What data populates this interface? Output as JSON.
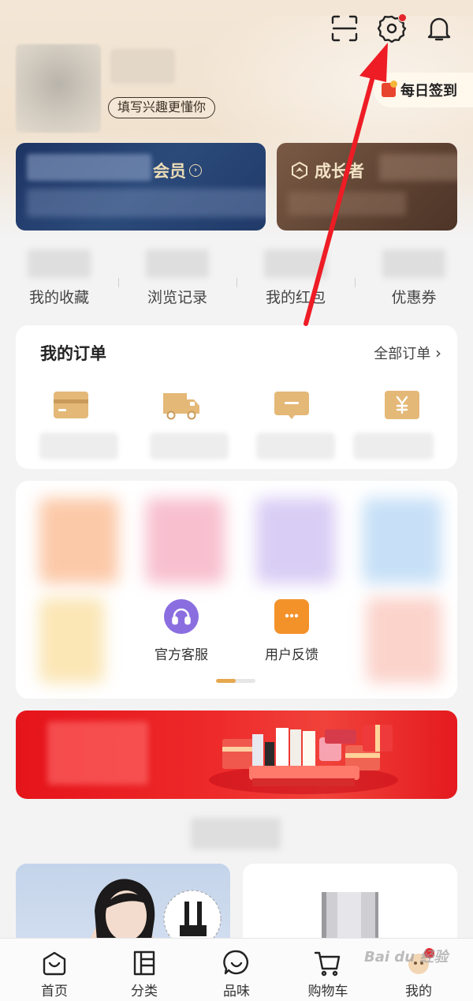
{
  "profile": {
    "interest_pill": "填写兴趣更懂你",
    "checkin_label": "每日签到"
  },
  "cards": {
    "member_title": "会员",
    "growth_title": "成长者"
  },
  "quick_stats": [
    {
      "label": "我的收藏"
    },
    {
      "label": "浏览记录"
    },
    {
      "label": "我的红包"
    },
    {
      "label": "优惠券"
    }
  ],
  "orders": {
    "title": "我的订单",
    "all_label": "全部订单",
    "icons": [
      "wallet-icon",
      "truck-icon",
      "comment-icon",
      "refund-icon"
    ]
  },
  "services": {
    "items": [
      {
        "label": "官方客服",
        "icon": "headset-icon",
        "color": "#8a6ee0"
      },
      {
        "label": "用户反馈",
        "icon": "chat-bubble-icon",
        "color": "#f4922a"
      }
    ],
    "pager_progress": 0.5
  },
  "tabbar": {
    "tabs": [
      {
        "label": "首页",
        "icon": "home-icon"
      },
      {
        "label": "分类",
        "icon": "category-icon"
      },
      {
        "label": "品味",
        "icon": "smile-icon"
      },
      {
        "label": "购物车",
        "icon": "cart-icon"
      },
      {
        "label": "我的",
        "icon": "profile-icon",
        "active": true
      }
    ]
  },
  "watermark": "Bai du 经验",
  "colors": {
    "accent_red": "#e3262c",
    "gold": "#e0b06a",
    "member_blue": "#1d3463",
    "growth_brown": "#5e4232"
  }
}
